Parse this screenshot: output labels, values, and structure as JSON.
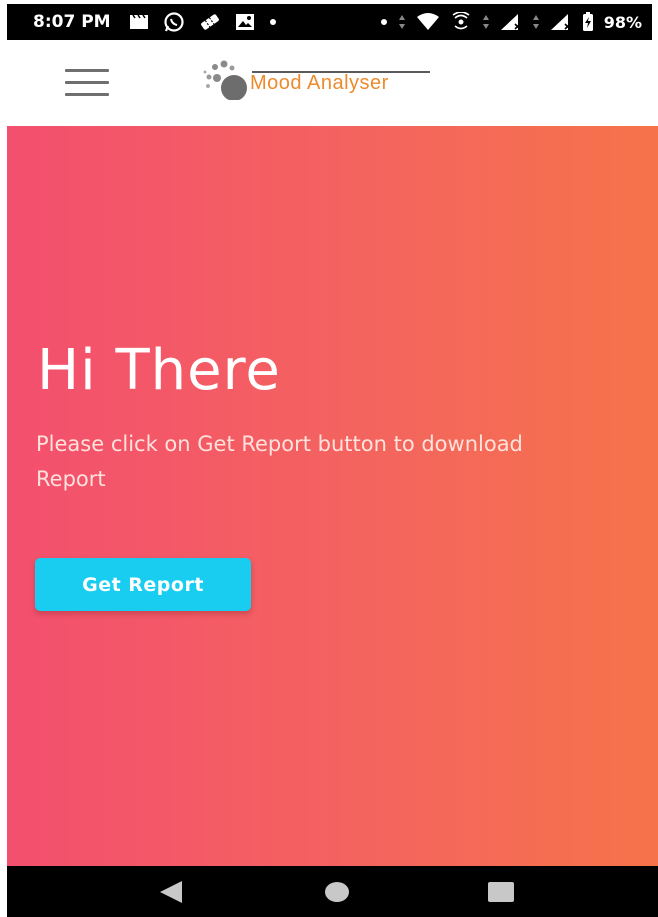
{
  "status_bar": {
    "time": "8:07 PM",
    "battery": "98%",
    "icons": [
      "clapperboard-icon",
      "whatsapp-icon",
      "ticket-icon",
      "gallery-icon",
      "dot-icon",
      "dot-icon",
      "data-arrows-icon",
      "wifi-icon",
      "hotspot-icon",
      "data-arrows-icon",
      "signal-icon",
      "data-arrows-icon",
      "signal-icon",
      "battery-charging-icon"
    ]
  },
  "header": {
    "menu_icon": "hamburger-menu-icon",
    "logo_text": "Mood Analyser"
  },
  "hero": {
    "title": "Hi There",
    "subtitle": "Please click on Get Report button to download Report",
    "button_label": "Get Report"
  },
  "nav_bar": {
    "icons": [
      "back-triangle-icon",
      "home-circle-icon",
      "recents-square-icon"
    ]
  },
  "colors": {
    "gradient_start": "#f34f6e",
    "gradient_end": "#f6734a",
    "button": "#18cdef",
    "logo_text": "#ee8a2e"
  }
}
